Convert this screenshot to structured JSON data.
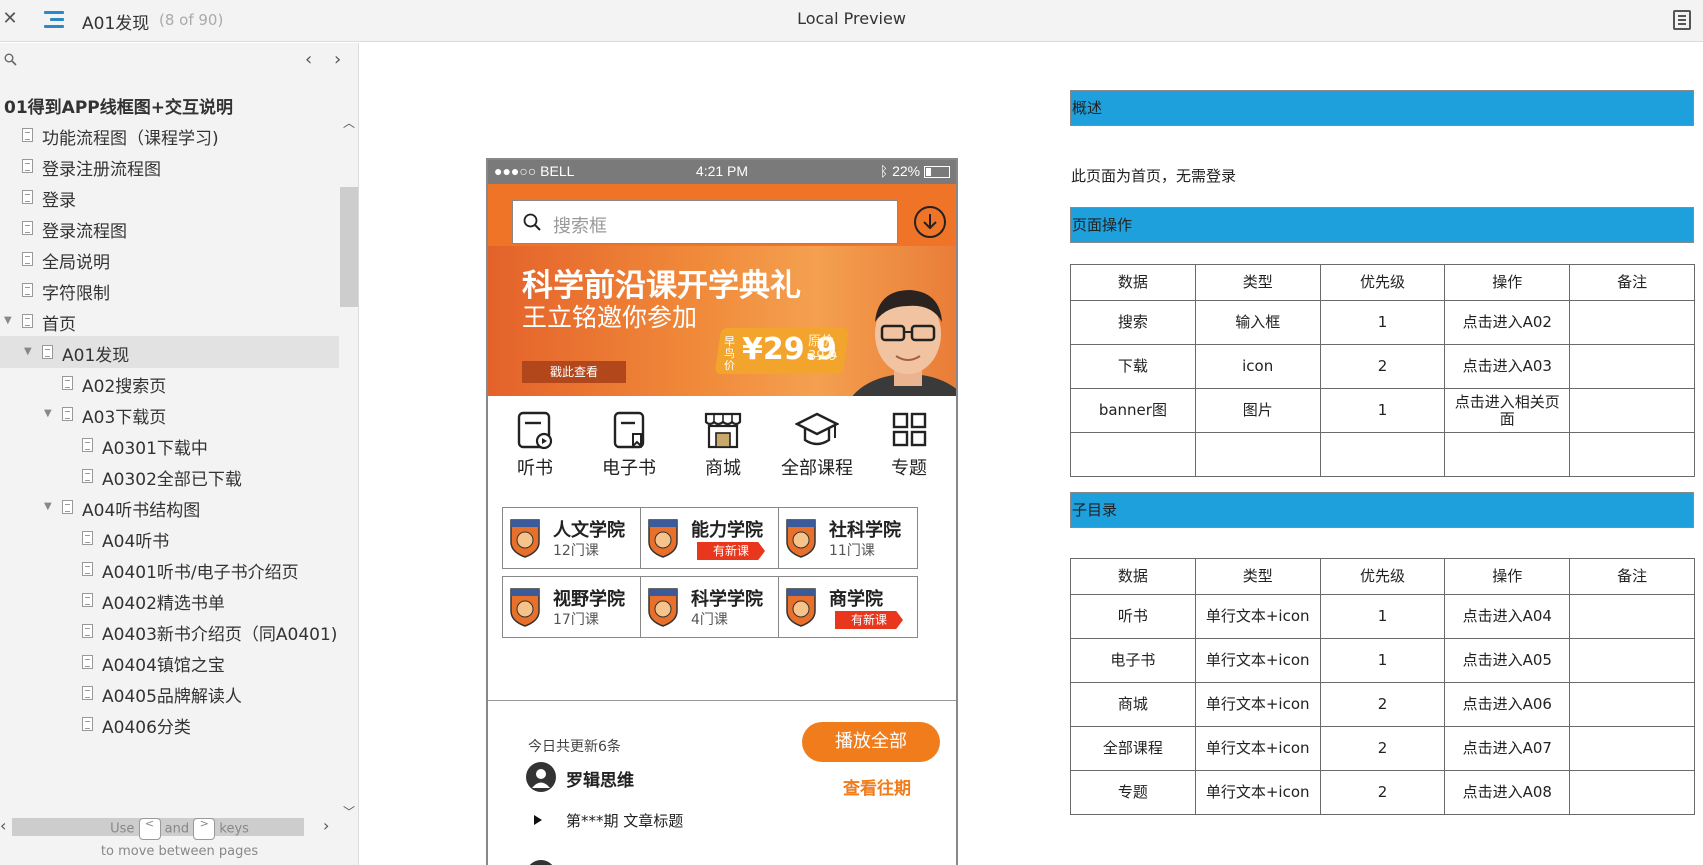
{
  "topbar": {
    "page_title": "A01发现",
    "page_count": "(8 of 90)",
    "center_title": "Local Preview"
  },
  "sidebar": {
    "root": "01得到APP线框图+交互说明",
    "items": [
      {
        "label": "功能流程图（课程学习)",
        "level": 1,
        "toggle": false
      },
      {
        "label": "登录注册流程图",
        "level": 1,
        "toggle": false
      },
      {
        "label": "登录",
        "level": 1,
        "toggle": false
      },
      {
        "label": "登录流程图",
        "level": 1,
        "toggle": false
      },
      {
        "label": "全局说明",
        "level": 1,
        "toggle": false
      },
      {
        "label": "字符限制",
        "level": 1,
        "toggle": false
      },
      {
        "label": "首页",
        "level": 1,
        "toggle": true,
        "nopage": true
      },
      {
        "label": "A01发现",
        "level": 2,
        "toggle": true,
        "selected": true
      },
      {
        "label": "A02搜索页",
        "level": 3,
        "toggle": false
      },
      {
        "label": "A03下载页",
        "level": 3,
        "toggle": true
      },
      {
        "label": "A0301下载中",
        "level": 4,
        "toggle": false
      },
      {
        "label": "A0302全部已下载",
        "level": 4,
        "toggle": false
      },
      {
        "label": "A04听书结构图",
        "level": 3,
        "toggle": true
      },
      {
        "label": "A04听书",
        "level": 4,
        "toggle": false
      },
      {
        "label": "A0401听书/电子书介绍页",
        "level": 4,
        "toggle": false
      },
      {
        "label": "A0402精选书单",
        "level": 4,
        "toggle": false
      },
      {
        "label": "A0403新书介绍页（同A0401)",
        "level": 4,
        "toggle": false
      },
      {
        "label": "A0404镇馆之宝",
        "level": 4,
        "toggle": false
      },
      {
        "label": "A0405品牌解读人",
        "level": 4,
        "toggle": false
      },
      {
        "label": "A0406分类",
        "level": 4,
        "toggle": false
      }
    ],
    "help": {
      "use": "Use",
      "key_prev": "<",
      "and": "and",
      "key_next": ">",
      "keys": "keys",
      "line2": "to move between pages"
    }
  },
  "phone": {
    "status": {
      "carrier": "●●●○○ BELL",
      "time": "4:21 PM",
      "battery": "22%"
    },
    "search_placeholder": "搜索框",
    "banner": {
      "line1": "科学前沿课开学典礼",
      "line2": "王立铭邀你参加",
      "button": "戳此查看",
      "early": "早鸟价",
      "price": "¥29.9",
      "orig_label": "原价",
      "orig_price": "39.9"
    },
    "nav": [
      {
        "label": "听书",
        "icon": "audiobook-icon"
      },
      {
        "label": "电子书",
        "icon": "ebook-icon"
      },
      {
        "label": "商城",
        "icon": "store-icon"
      },
      {
        "label": "全部课程",
        "icon": "graduation-cap-icon"
      },
      {
        "label": "专题",
        "icon": "grid-icon"
      }
    ],
    "colleges": [
      {
        "name": "人文学院",
        "sub": "12门课",
        "tag": ""
      },
      {
        "name": "能力学院",
        "sub": "",
        "tag": "有新课"
      },
      {
        "name": "社科学院",
        "sub": "11门课",
        "tag": ""
      },
      {
        "name": "视野学院",
        "sub": "17门课",
        "tag": ""
      },
      {
        "name": "科学学院",
        "sub": "4门课",
        "tag": ""
      },
      {
        "name": "商学院",
        "sub": "",
        "tag": "有新课"
      }
    ],
    "today": "今日共更新6条",
    "play_all": "播放全部",
    "history": "查看往期",
    "author": "罗辑思维",
    "article": "第***期 文章标题"
  },
  "doc": {
    "overview_header": "概述",
    "overview_text": "此页面为首页，无需登录",
    "ops_header": "页面操作",
    "sub_header": "子目录",
    "columns": [
      "数据",
      "类型",
      "优先级",
      "操作",
      "备注"
    ],
    "ops_rows": [
      [
        "搜索",
        "输入框",
        "1",
        "点击进入A02",
        ""
      ],
      [
        "下载",
        "icon",
        "2",
        "点击进入A03",
        ""
      ],
      [
        "banner图",
        "图片",
        "1",
        "点击进入相关页面",
        ""
      ],
      [
        "",
        "",
        "",
        "",
        ""
      ]
    ],
    "sub_rows": [
      [
        "听书",
        "单行文本+icon",
        "1",
        "点击进入A04",
        ""
      ],
      [
        "电子书",
        "单行文本+icon",
        "1",
        "点击进入A05",
        ""
      ],
      [
        "商城",
        "单行文本+icon",
        "2",
        "点击进入A06",
        ""
      ],
      [
        "全部课程",
        "单行文本+icon",
        "2",
        "点击进入A07",
        ""
      ],
      [
        "专题",
        "单行文本+icon",
        "2",
        "点击进入A08",
        ""
      ]
    ]
  },
  "colors": {
    "accent_blue": "#1ea0dc",
    "orange": "#f07c1c",
    "tag_red": "#e8371d"
  }
}
